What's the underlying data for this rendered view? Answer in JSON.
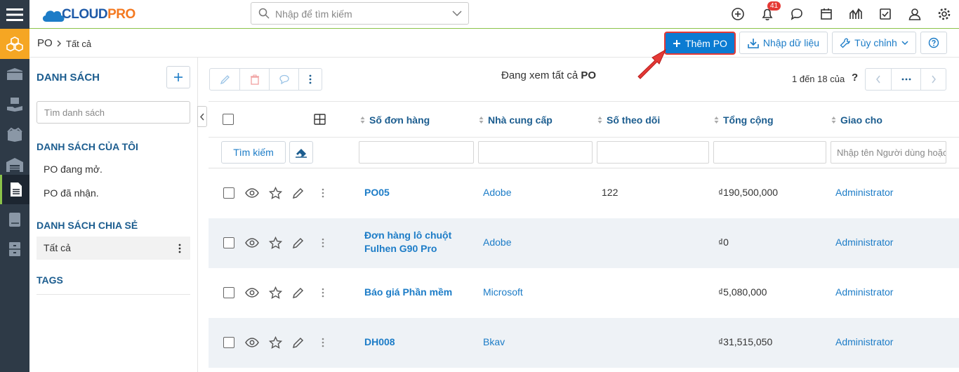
{
  "header": {
    "logo_prefix": "CLOUD",
    "logo_suffix": "PRO",
    "search_placeholder": "Nhập để tìm kiếm",
    "notification_count": "41"
  },
  "breadcrumb": {
    "module": "PO",
    "view": "Tất cả"
  },
  "toolbar": {
    "add_label": "Thêm PO",
    "import_label": "Nhập dữ liệu",
    "customize_label": "Tùy chỉnh"
  },
  "left": {
    "list_title": "DANH SÁCH",
    "search_placeholder": "Tìm danh sách",
    "my_lists_title": "DANH SÁCH CỦA TÔI",
    "my_lists": [
      "PO đang mở.",
      "PO đã nhận."
    ],
    "shared_title": "DANH SÁCH CHIA SẺ",
    "shared_lists": [
      "Tất cả"
    ],
    "tags_title": "TAGS"
  },
  "grid": {
    "viewing_prefix": "Đang xem tất cả",
    "viewing_module": "PO",
    "pagination": "1 đến 18 của",
    "pagination_help": "?",
    "search_button": "Tìm kiếm",
    "columns": [
      "Số đơn hàng",
      "Nhà cung cấp",
      "Số theo dõi",
      "Tổng cộng",
      "Giao cho"
    ],
    "assignee_placeholder": "Nhập tên Người dùng hoặc",
    "rows": [
      {
        "order": "PO05",
        "order2": "",
        "vendor": "Adobe",
        "tracking": "122",
        "total": "₫190,500,000",
        "assignee": "Administrator"
      },
      {
        "order": "Đơn hàng lô chuột",
        "order2": "Fulhen G90 Pro",
        "vendor": "Adobe",
        "tracking": "",
        "total": "₫0",
        "assignee": "Administrator"
      },
      {
        "order": "Báo giá Phần mềm",
        "order2": "",
        "vendor": "Microsoft",
        "tracking": "",
        "total": "₫5,080,000",
        "assignee": "Administrator"
      },
      {
        "order": "DH008",
        "order2": "",
        "vendor": "Bkav",
        "tracking": "",
        "total": "₫31,515,050",
        "assignee": "Administrator"
      }
    ]
  },
  "colors": {
    "sidebar": "#2e3a47",
    "accent": "#1c7cc7",
    "primary_button": "#0b7bd2",
    "highlight": "#e53935",
    "active_module": "#f5a623"
  }
}
